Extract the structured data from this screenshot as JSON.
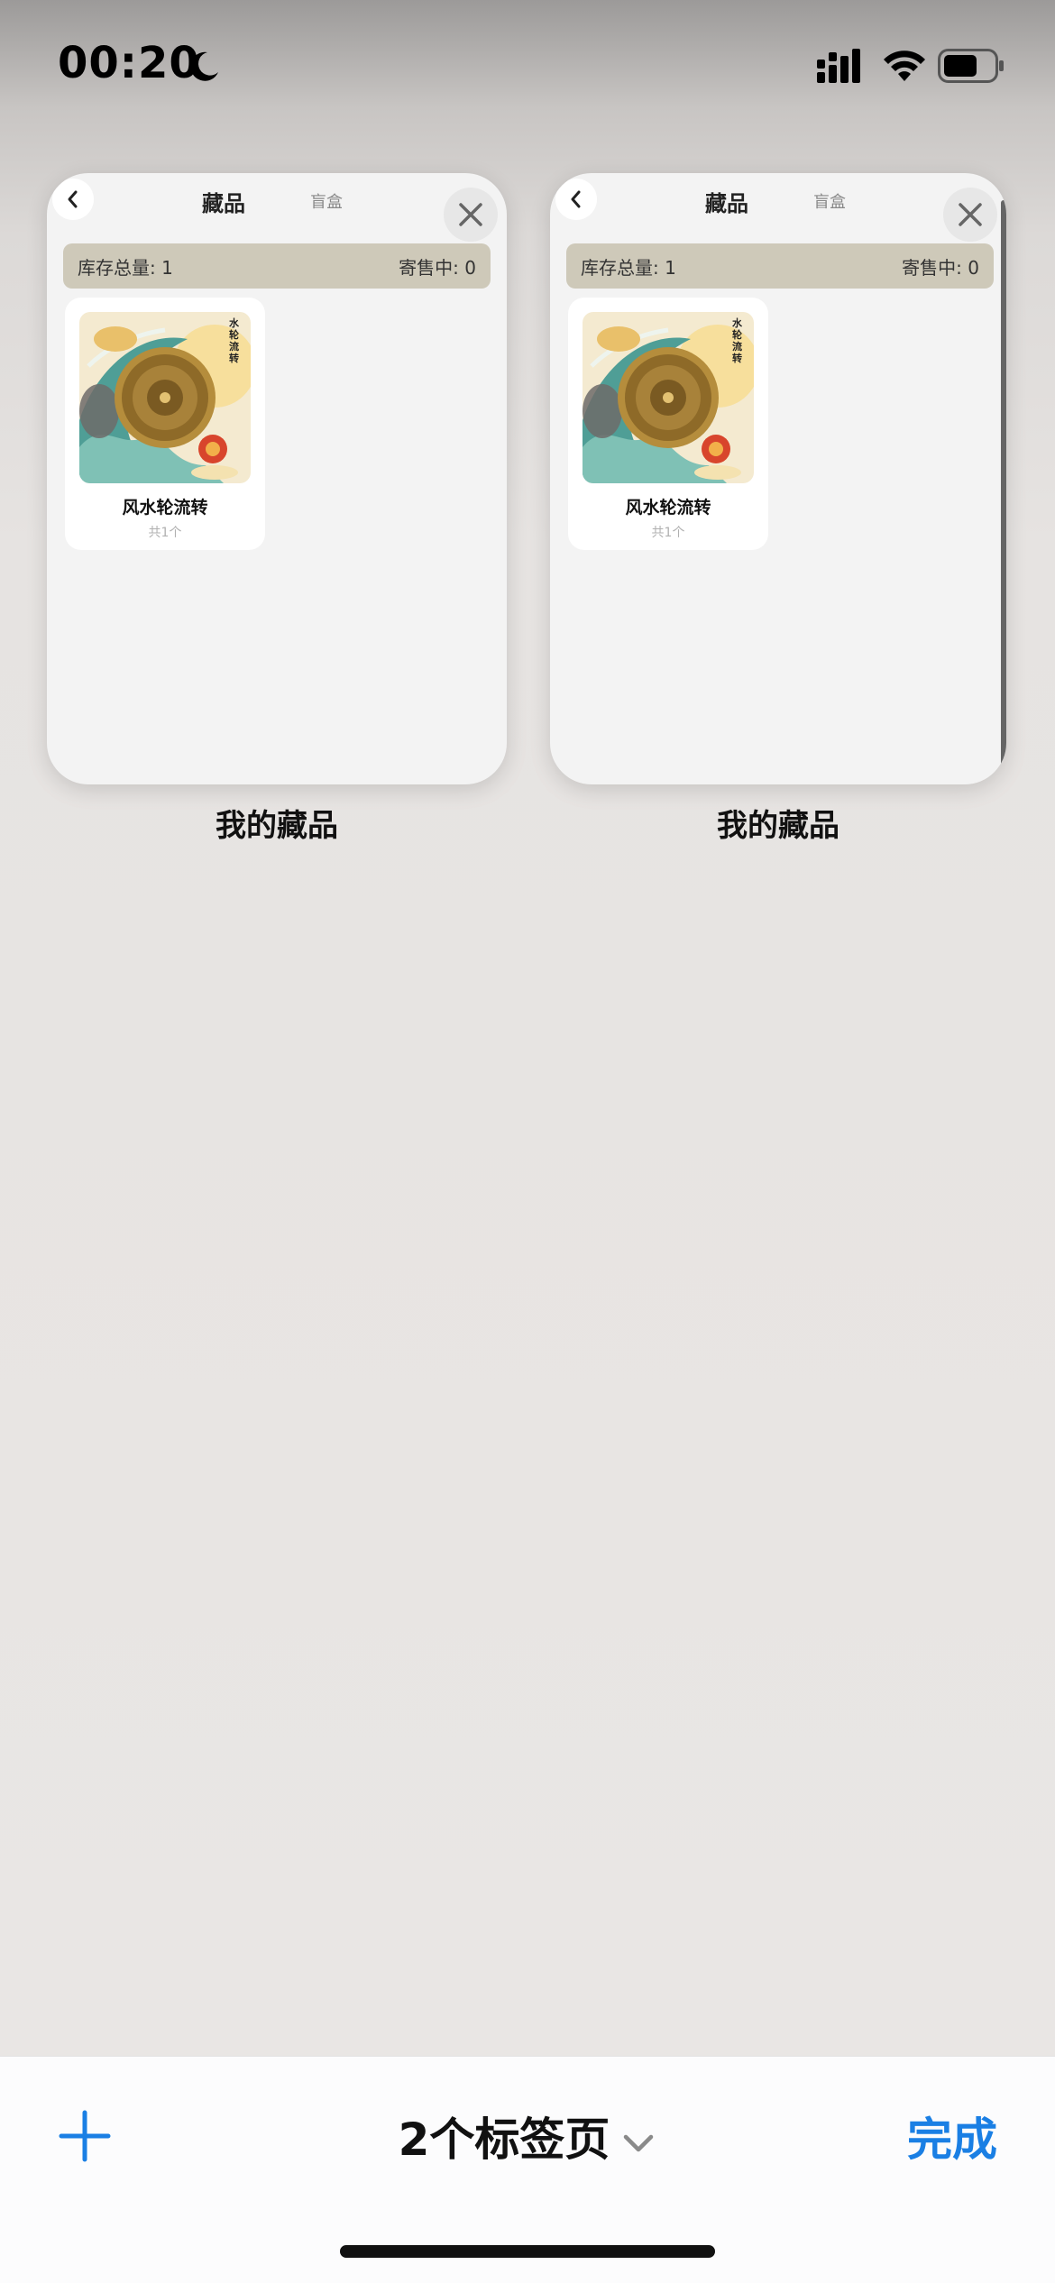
{
  "status_bar": {
    "time": "00:20",
    "icons": [
      "moon-icon",
      "signal-icon",
      "wifi-icon",
      "battery-icon"
    ]
  },
  "tabs": [
    {
      "nav_title": "藏品",
      "nav_secondary": "盲盒",
      "stats_left": "库存总量: 1",
      "stats_right": "寄售中: 0",
      "item_name": "风水轮流转",
      "item_count": "共1个",
      "tab_title": "我的藏品"
    },
    {
      "nav_title": "藏品",
      "nav_secondary": "盲盒",
      "stats_left": "库存总量: 1",
      "stats_right": "寄售中: 0",
      "item_name": "风水轮流转",
      "item_count": "共1个",
      "tab_title": "我的藏品"
    }
  ],
  "image_text": "水轮流转",
  "toolbar": {
    "tabs_count_label": "2个标签页",
    "done_label": "完成"
  },
  "colors": {
    "accent": "#1a7fe4",
    "stats_bar": "#cec9b9"
  }
}
